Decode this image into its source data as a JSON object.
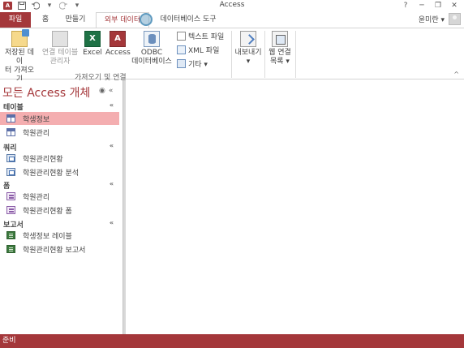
{
  "window": {
    "title": "Access",
    "help": "?",
    "controls": [
      "─",
      "❐",
      "✕"
    ]
  },
  "qat": {
    "undo_icon": "undo-icon",
    "redo_icon": "redo-icon",
    "customize": "▾"
  },
  "tabs": [
    {
      "label": "파일"
    },
    {
      "label": "홈"
    },
    {
      "label": "만들기"
    },
    {
      "label": "외부 데이터"
    },
    {
      "label": "데이터베이스 도구"
    }
  ],
  "user": {
    "name": "윤미란 ▾"
  },
  "ribbon": {
    "buttons": {
      "saved_imports": "저장된 데이\n터 가져오기",
      "linked_table_manager": "연결 테이블\n관리자",
      "excel": "Excel",
      "access": "Access",
      "odbc": "ODBC\n데이터베이스",
      "text_file": "텍스트 파일",
      "xml_file": "XML 파일",
      "more": "기타 ▾",
      "export": "내보내기\n▾",
      "web_linked_list": "웹 연결\n목록 ▾"
    },
    "group_label": "가져오기 및 연결",
    "collapse": "^"
  },
  "nav": {
    "title": "모든 Access 개체",
    "dropdown": "◉",
    "shutter": "«",
    "sections": [
      {
        "label": "테이블",
        "caret": "«",
        "items": [
          {
            "label": "학생정보",
            "selected": true,
            "icon": "table-icon"
          },
          {
            "label": "학원관리",
            "selected": false,
            "icon": "table-icon"
          }
        ]
      },
      {
        "label": "쿼리",
        "caret": "«",
        "items": [
          {
            "label": "학원관리현황",
            "icon": "query-icon"
          },
          {
            "label": "학원관리현황 분석",
            "icon": "query-icon"
          }
        ]
      },
      {
        "label": "폼",
        "caret": "«",
        "items": [
          {
            "label": "학원관리",
            "icon": "form-icon"
          },
          {
            "label": "학원관리현황 폼",
            "icon": "form-icon"
          }
        ]
      },
      {
        "label": "보고서",
        "caret": "«",
        "items": [
          {
            "label": "학생정보 레이블",
            "icon": "report-icon"
          },
          {
            "label": "학원관리현황 보고서",
            "icon": "report-icon"
          }
        ]
      }
    ]
  },
  "status": {
    "text": "준비"
  },
  "colors": {
    "accent": "#a4373a",
    "selected": "#f4aeb0"
  }
}
